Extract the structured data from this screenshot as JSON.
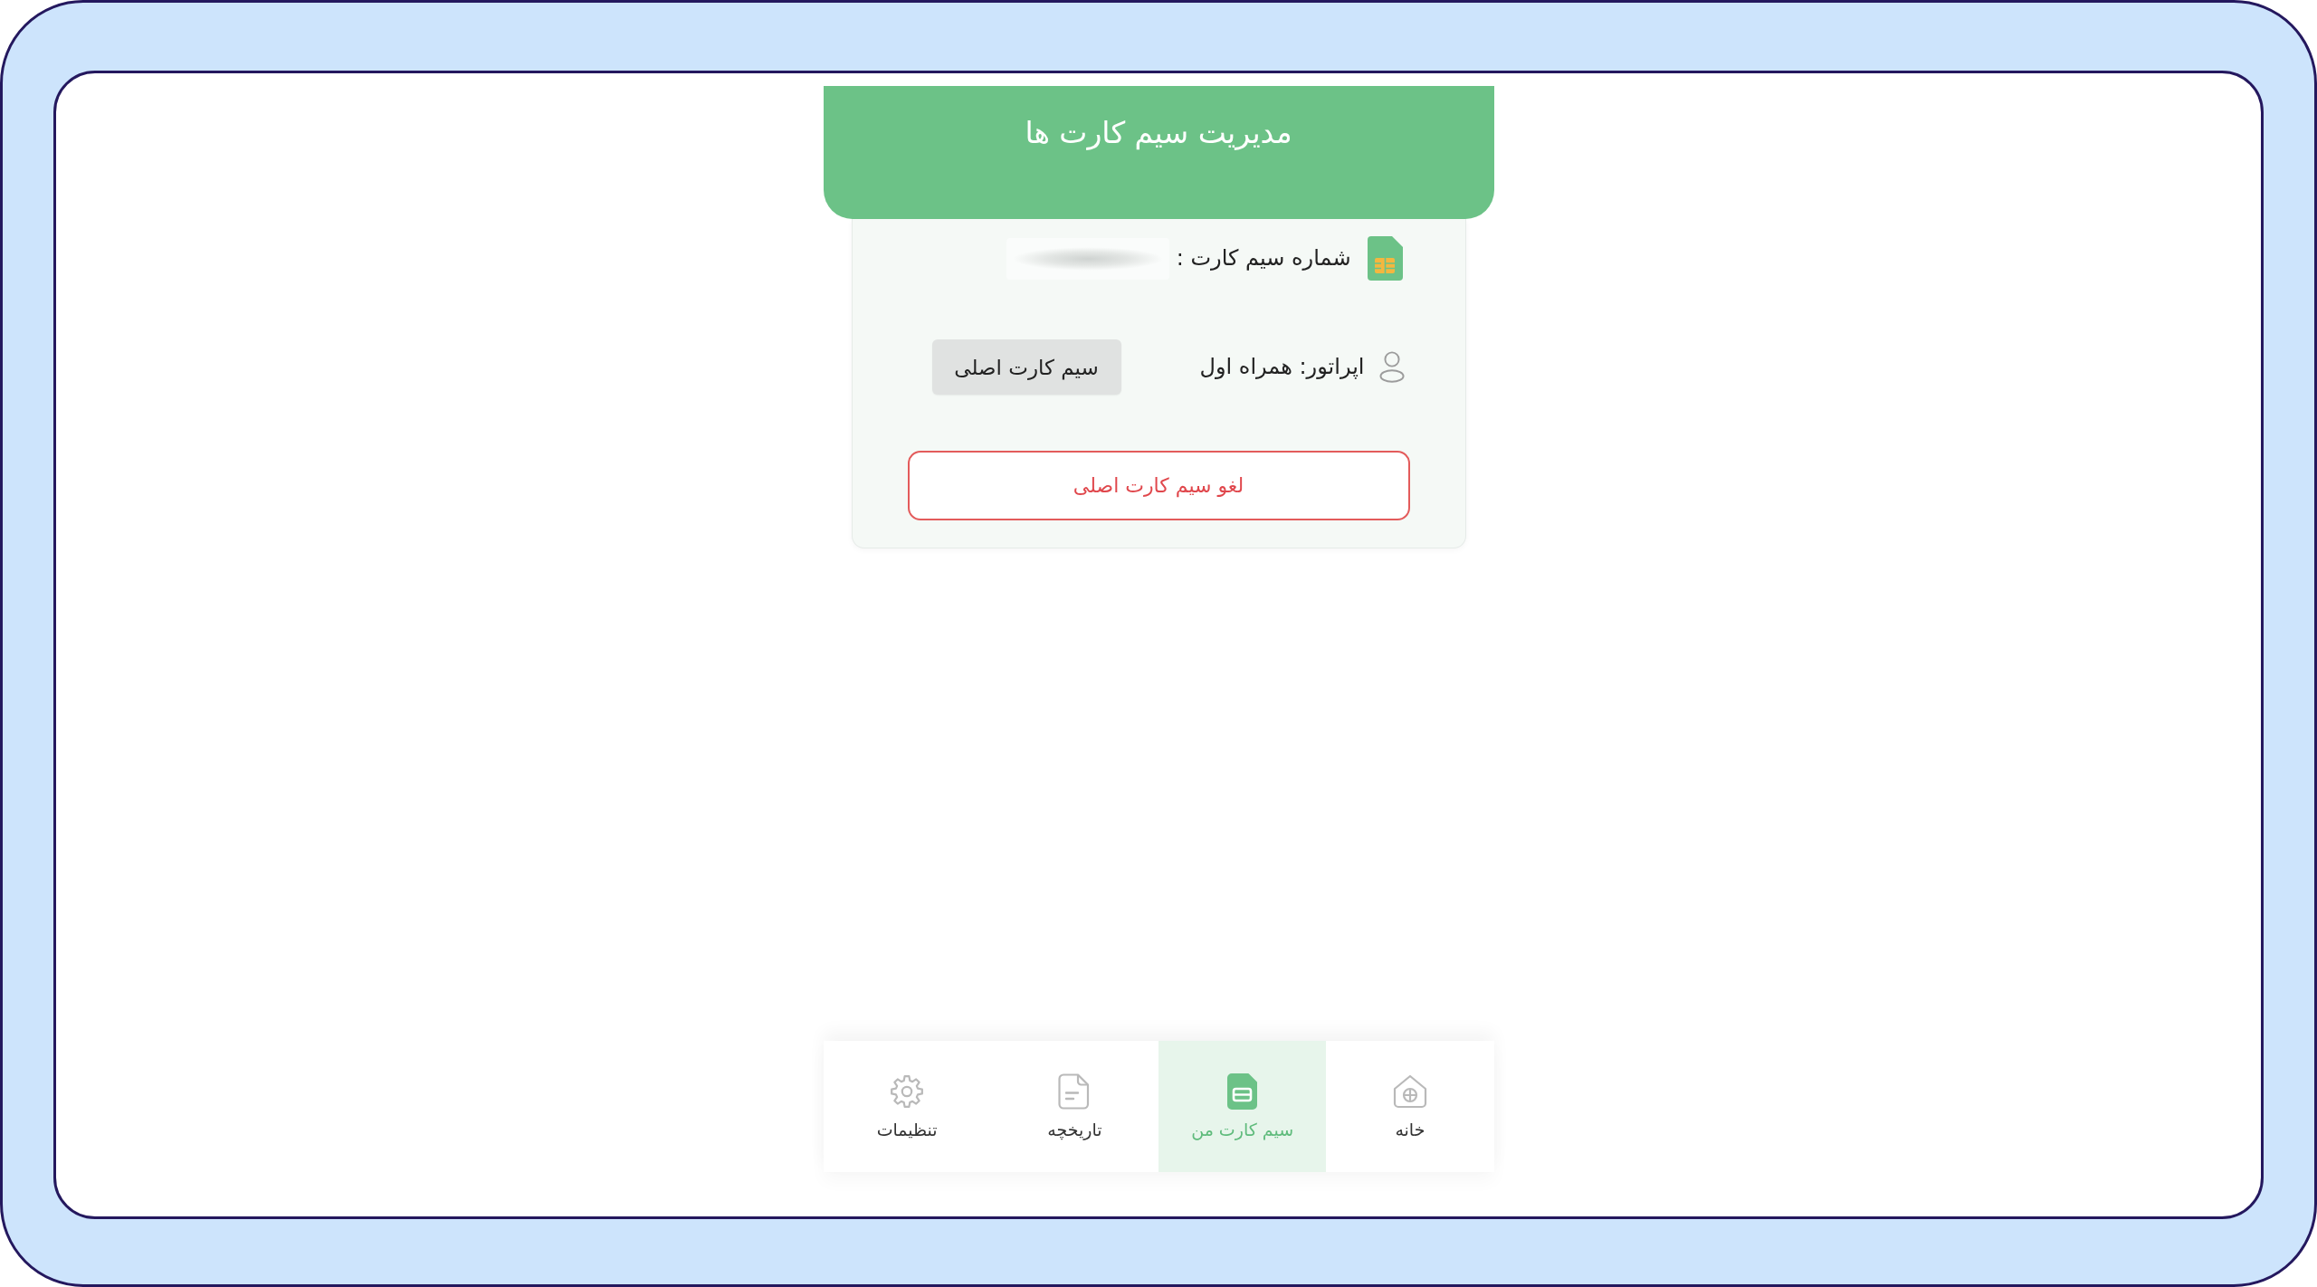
{
  "header": {
    "title": "مدیریت سیم کارت ها"
  },
  "sim_card": {
    "number_label": "شماره سیم کارت :",
    "operator": "اپراتور: همراه اول",
    "tag": "سیم کارت اصلی",
    "cancel_button": "لغو سیم کارت اصلی"
  },
  "bottom_nav": [
    {
      "label": "خانه",
      "kind": "home",
      "selected": false
    },
    {
      "label": "سیم کارت من",
      "kind": "sim",
      "selected": true
    },
    {
      "label": "تاریخچه",
      "kind": "history",
      "selected": false
    },
    {
      "label": "تنظیمات",
      "kind": "settings",
      "selected": false
    }
  ]
}
